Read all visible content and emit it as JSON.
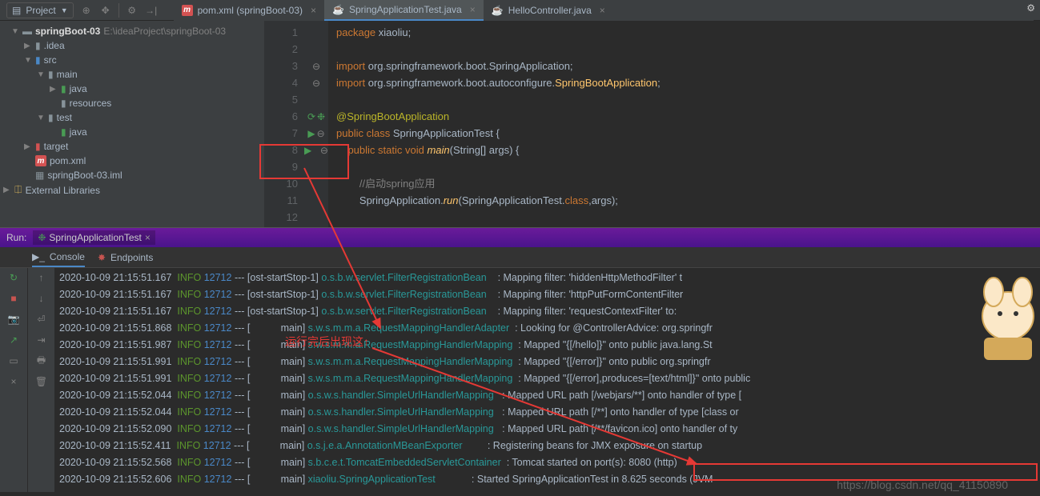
{
  "toolbar": {
    "project_label": "Project"
  },
  "tabs": [
    {
      "icon": "m",
      "label": "pom.xml (springBoot-03)",
      "active": false
    },
    {
      "icon": "j",
      "label": "SpringApplicationTest.java",
      "active": true
    },
    {
      "icon": "j",
      "label": "HelloController.java",
      "active": false
    }
  ],
  "tree": {
    "root_name": "springBoot-03",
    "root_path": "E:\\ideaProject\\springBoot-03",
    "nodes": [
      {
        "indent": 1,
        "arrow": "▶",
        "icon": "folder",
        "label": ".idea"
      },
      {
        "indent": 1,
        "arrow": "▼",
        "icon": "folder-src",
        "label": "src"
      },
      {
        "indent": 2,
        "arrow": "▼",
        "icon": "folder",
        "label": "main"
      },
      {
        "indent": 3,
        "arrow": "▶",
        "icon": "folder-src",
        "label": "java"
      },
      {
        "indent": 3,
        "arrow": "",
        "icon": "folder",
        "label": "resources"
      },
      {
        "indent": 2,
        "arrow": "▼",
        "icon": "folder",
        "label": "test"
      },
      {
        "indent": 3,
        "arrow": "",
        "icon": "folder-src",
        "label": "java"
      },
      {
        "indent": 1,
        "arrow": "▶",
        "icon": "folder-hl",
        "label": "target"
      },
      {
        "indent": 1,
        "arrow": "",
        "icon": "m",
        "label": "pom.xml"
      },
      {
        "indent": 1,
        "arrow": "",
        "icon": "file",
        "label": "springBoot-03.iml"
      }
    ],
    "ext_lib": "External Libraries"
  },
  "code": {
    "lines": [
      {
        "n": 1,
        "html": "<span class='kw'>package</span> xiaoliu;"
      },
      {
        "n": 2,
        "html": ""
      },
      {
        "n": 3,
        "html": "<span class='kw'>import</span> org.springframework.boot.SpringApplication;",
        "gut": "fold"
      },
      {
        "n": 4,
        "html": "<span class='kw'>import</span> org.springframework.boot.autoconfigure.<span class='id'>SpringBootApplication</span>;",
        "gut": "fold"
      },
      {
        "n": 5,
        "html": ""
      },
      {
        "n": 6,
        "html": "<span class='an'>@SpringBootApplication</span>",
        "gut": "run2"
      },
      {
        "n": 7,
        "html": "<span class='kw'>public class</span> SpringApplicationTest {",
        "gut": "run"
      },
      {
        "n": 8,
        "html": "    <span class='kw'>public static void</span> <span class='fn'>main</span>(String[] args) {",
        "gut": "playfold"
      },
      {
        "n": 9,
        "html": ""
      },
      {
        "n": 10,
        "html": "        <span class='cm'>//启动spring应用</span>"
      },
      {
        "n": 11,
        "html": "        SpringApplication.<span class='fn'>run</span>(SpringApplicationTest.<span class='kw'>class</span>,args);"
      },
      {
        "n": 12,
        "html": ""
      }
    ]
  },
  "run": {
    "title": "Run:",
    "tab_label": "SpringApplicationTest",
    "sub_console": "Console",
    "sub_endpoints": "Endpoints"
  },
  "console_lines": [
    {
      "ts": "2020-10-09 21:15:51.167",
      "lvl": "INFO",
      "pid": "12712",
      "thr": "[ost-startStop-1]",
      "cat": "o.s.b.w.servlet.FilterRegistrationBean   ",
      "msg": ": Mapping filter: 'hiddenHttpMethodFilter' t"
    },
    {
      "ts": "2020-10-09 21:15:51.167",
      "lvl": "INFO",
      "pid": "12712",
      "thr": "[ost-startStop-1]",
      "cat": "o.s.b.w.servlet.FilterRegistrationBean   ",
      "msg": ": Mapping filter: 'httpPutFormContentFilter"
    },
    {
      "ts": "2020-10-09 21:15:51.167",
      "lvl": "INFO",
      "pid": "12712",
      "thr": "[ost-startStop-1]",
      "cat": "o.s.b.w.servlet.FilterRegistrationBean   ",
      "msg": ": Mapping filter: 'requestContextFilter' to:"
    },
    {
      "ts": "2020-10-09 21:15:51.868",
      "lvl": "INFO",
      "pid": "12712",
      "thr": "[           main]",
      "cat": "s.w.s.m.m.a.RequestMappingHandlerAdapter ",
      "msg": ": Looking for @ControllerAdvice: org.springfr"
    },
    {
      "ts": "2020-10-09 21:15:51.987",
      "lvl": "INFO",
      "pid": "12712",
      "thr": "[           main]",
      "cat": "s.w.s.m.m.a.RequestMappingHandlerMapping ",
      "msg": ": Mapped \"{[/hello]}\" onto public java.lang.St"
    },
    {
      "ts": "2020-10-09 21:15:51.991",
      "lvl": "INFO",
      "pid": "12712",
      "thr": "[           main]",
      "cat": "s.w.s.m.m.a.RequestMappingHandlerMapping ",
      "msg": ": Mapped \"{[/error]}\" onto public org.springfr"
    },
    {
      "ts": "2020-10-09 21:15:51.991",
      "lvl": "INFO",
      "pid": "12712",
      "thr": "[           main]",
      "cat": "s.w.s.m.m.a.RequestMappingHandlerMapping ",
      "msg": ": Mapped \"{[/error],produces=[text/html]}\" onto public"
    },
    {
      "ts": "2020-10-09 21:15:52.044",
      "lvl": "INFO",
      "pid": "12712",
      "thr": "[           main]",
      "cat": "o.s.w.s.handler.SimpleUrlHandlerMapping  ",
      "msg": ": Mapped URL path [/webjars/**] onto handler of type ["
    },
    {
      "ts": "2020-10-09 21:15:52.044",
      "lvl": "INFO",
      "pid": "12712",
      "thr": "[           main]",
      "cat": "o.s.w.s.handler.SimpleUrlHandlerMapping  ",
      "msg": ": Mapped URL path [/**] onto handler of type [class or"
    },
    {
      "ts": "2020-10-09 21:15:52.090",
      "lvl": "INFO",
      "pid": "12712",
      "thr": "[           main]",
      "cat": "o.s.w.s.handler.SimpleUrlHandlerMapping  ",
      "msg": ": Mapped URL path [/**/favicon.ico] onto handler of ty"
    },
    {
      "ts": "2020-10-09 21:15:52.411",
      "lvl": "INFO",
      "pid": "12712",
      "thr": "[           main]",
      "cat": "o.s.j.e.a.AnnotationMBeanExporter        ",
      "msg": ": Registering beans for JMX exposure on startup"
    },
    {
      "ts": "2020-10-09 21:15:52.568",
      "lvl": "INFO",
      "pid": "12712",
      "thr": "[           main]",
      "cat": "s.b.c.e.t.TomcatEmbeddedServletContainer ",
      "msg": ": Tomcat started on port(s): 8080 (http)"
    },
    {
      "ts": "2020-10-09 21:15:52.606",
      "lvl": "INFO",
      "pid": "12712",
      "thr": "[           main]",
      "cat": "xiaoliu.SpringApplicationTest            ",
      "msg": ": Started SpringApplicationTest in 8.625 seconds (JVM"
    }
  ],
  "annotations": {
    "red_text": "运行完后出现这↑",
    "watermark": "https://blog.csdn.net/qq_41150890"
  }
}
